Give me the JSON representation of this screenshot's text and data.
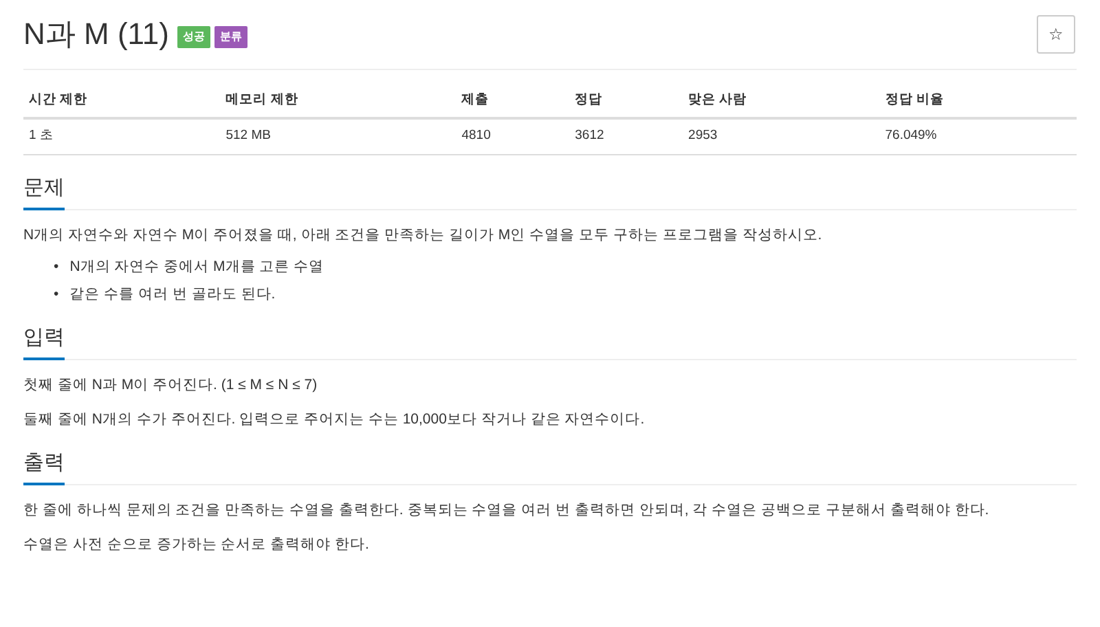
{
  "title": "N과 M (11)",
  "badges": [
    {
      "label": "성공",
      "color": "#5cb85c"
    },
    {
      "label": "분류",
      "color": "#9b59b6"
    }
  ],
  "star_button": "☆",
  "stats": {
    "columns": [
      "시간 제한",
      "메모리 제한",
      "제출",
      "정답",
      "맞은 사람",
      "정답 비율"
    ],
    "rows": [
      [
        "1 초",
        "512 MB",
        "4810",
        "3612",
        "2953",
        "76.049%"
      ]
    ]
  },
  "sections": [
    {
      "heading": "문제",
      "paragraphs": [
        "N개의 자연수와 자연수 M이 주어졌을 때, 아래 조건을 만족하는 길이가 M인 수열을 모두 구하는 프로그램을 작성하시오."
      ],
      "bullets": [
        {
          "marker": "•",
          "text": "N개의 자연수 중에서 M개를 고른 수열"
        },
        {
          "marker": "•",
          "text": "같은 수를 여러 번 골라도 된다."
        }
      ]
    },
    {
      "heading": "입력",
      "paragraphs": [
        "첫째 줄에 N과 M이 주어진다. (1 ≤ M ≤ N ≤ 7)",
        "둘째 줄에 N개의 수가 주어진다. 입력으로 주어지는 수는 10,000보다 작거나 같은 자연수이다."
      ]
    },
    {
      "heading": "출력",
      "paragraphs": [
        "한 줄에 하나씩 문제의 조건을 만족하는 수열을 출력한다. 중복되는 수열을 여러 번 출력하면 안되며, 각 수열은 공백으로 구분해서 출력해야 한다.",
        "수열은 사전 순으로 증가하는 순서로 출력해야 한다."
      ]
    }
  ]
}
